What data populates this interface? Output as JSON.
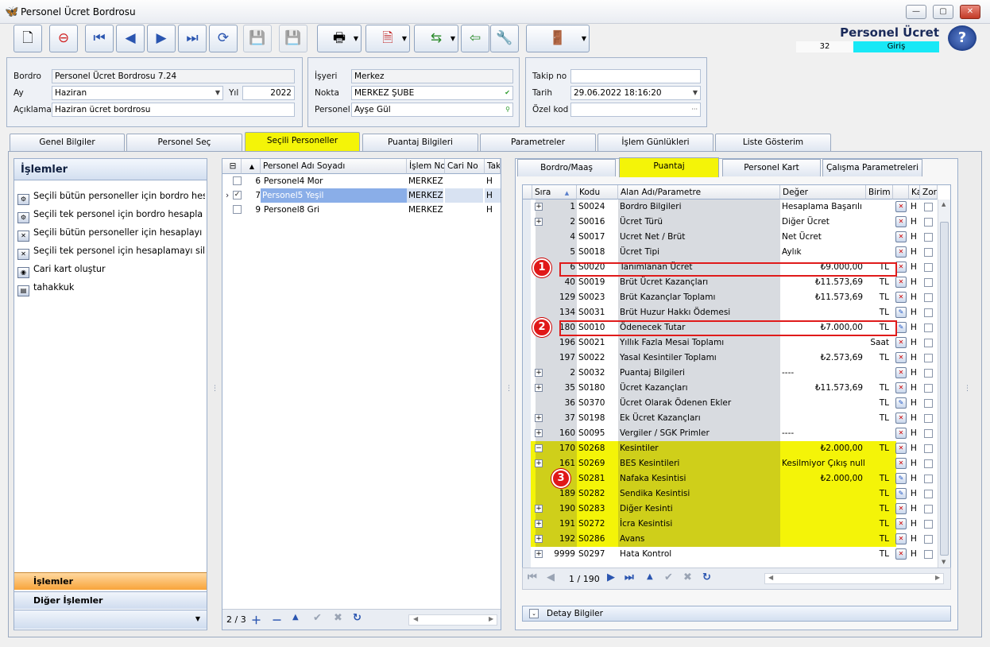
{
  "window": {
    "title": "Personel Ücret Bordrosu"
  },
  "header": {
    "title": "Personel Ücret Bordrosu",
    "count": "32",
    "mode": "Giriş"
  },
  "form": {
    "bordro_label": "Bordro",
    "bordro_value": "Personel Ücret Bordrosu 7.24",
    "ay_label": "Ay",
    "ay_value": "Haziran",
    "yil_label": "Yıl",
    "yil_value": "2022",
    "aciklama_label": "Açıklama",
    "aciklama_value": "Haziran ücret bordrosu",
    "isyeri_label": "İşyeri",
    "isyeri_value": "Merkez",
    "nokta_label": "Nokta",
    "nokta_value": "MERKEZ ŞUBE",
    "personel_label": "Personel",
    "personel_value": "Ayşe Gül",
    "takip_label": "Takip no",
    "takip_value": "",
    "tarih_label": "Tarih",
    "tarih_value": "29.06.2022 18:16:20",
    "ozel_label": "Özel kod",
    "ozel_value": ""
  },
  "main_tabs": [
    "Genel Bilgiler",
    "Personel Seç",
    "Seçili Personeller",
    "Puantaj Bilgileri",
    "Parametreler",
    "İşlem Günlükleri",
    "Liste Gösterim"
  ],
  "operations": {
    "title": "İşlemler",
    "items": [
      "Seçili bütün personeller için bordro hes...",
      "Seçili tek personel için bordro hesapla",
      "Seçili bütün personeller için hesaplayı sil",
      "Seçili tek personel için hesaplamayı sil",
      "Cari kart oluştur",
      "tahakkuk"
    ],
    "nav_islemler": "İşlemler",
    "nav_diger": "Diğer İşlemler"
  },
  "employees": {
    "columns": [
      "Personel Adı Soyadı",
      "İşlem Nok",
      "Cari No",
      "Tak"
    ],
    "rows": [
      {
        "no": "6",
        "name": "Personel4 Mor",
        "nokta": "MERKEZ Ş",
        "cari": "",
        "tak": "H",
        "checked": false
      },
      {
        "no": "7",
        "name": "Personel5 Yeşil",
        "nokta": "MERKEZ Ş",
        "cari": "",
        "tak": "H",
        "checked": true
      },
      {
        "no": "9",
        "name": "Personel8 Gri",
        "nokta": "MERKEZ Ş",
        "cari": "",
        "tak": "H",
        "checked": false
      }
    ],
    "pager": "2 / 3"
  },
  "sub_tabs": [
    "Bordro/Maaş",
    "Puantaj",
    "Personel Kart",
    "Çalışma Parametreleri"
  ],
  "grid": {
    "columns": [
      "Sıra",
      "Kodu",
      "Alan Adı/Parametre",
      "Değer",
      "Birim",
      "Ka",
      "Zor"
    ],
    "rows": [
      {
        "exp": "+",
        "sira": "1",
        "kod": "S0024",
        "ad": "Bordro Bilgileri",
        "deger": "Hesaplama Başarılı",
        "birim": "",
        "ka": "H"
      },
      {
        "exp": "+",
        "sira": "2",
        "kod": "S0016",
        "ad": "Ücret Türü",
        "deger": "Diğer Ücret",
        "birim": "",
        "ka": "H"
      },
      {
        "exp": "",
        "sira": "4",
        "kod": "S0017",
        "ad": "Ucret Net / Brüt",
        "deger": "Net Ücret",
        "birim": "",
        "ka": "H"
      },
      {
        "exp": "",
        "sira": "5",
        "kod": "S0018",
        "ad": "Ücret Tipi",
        "deger": "Aylık",
        "birim": "",
        "ka": "H"
      },
      {
        "exp": "",
        "sira": "6",
        "kod": "S0020",
        "ad": "Tanımlanan Ücret",
        "deger": "₺9.000,00",
        "birim": "TL",
        "ka": "H"
      },
      {
        "exp": "",
        "sira": "40",
        "kod": "S0019",
        "ad": "Brüt Ücret Kazançları",
        "deger": "₺11.573,69",
        "birim": "TL",
        "ka": "H"
      },
      {
        "exp": "",
        "sira": "129",
        "kod": "S0023",
        "ad": "Brüt Kazançlar Toplamı",
        "deger": "₺11.573,69",
        "birim": "TL",
        "ka": "H"
      },
      {
        "exp": "",
        "sira": "134",
        "kod": "S0031",
        "ad": "Brüt Huzur Hakkı Ödemesi",
        "deger": "",
        "birim": "TL",
        "ka": "H"
      },
      {
        "exp": "",
        "sira": "180",
        "kod": "S0010",
        "ad": "Ödenecek Tutar",
        "deger": "₺7.000,00",
        "birim": "TL",
        "ka": "H"
      },
      {
        "exp": "",
        "sira": "196",
        "kod": "S0021",
        "ad": "Yıllık Fazla Mesai Toplamı",
        "deger": "",
        "birim": "Saat",
        "ka": "H"
      },
      {
        "exp": "",
        "sira": "197",
        "kod": "S0022",
        "ad": "Yasal Kesintiler Toplamı",
        "deger": "₺2.573,69",
        "birim": "TL",
        "ka": "H"
      },
      {
        "exp": "+",
        "sira": "2",
        "kod": "S0032",
        "ad": "Puantaj Bilgileri",
        "deger": "----",
        "birim": "",
        "ka": "H"
      },
      {
        "exp": "+",
        "sira": "35",
        "kod": "S0180",
        "ad": "Ücret Kazançları",
        "deger": "₺11.573,69",
        "birim": "TL",
        "ka": "H"
      },
      {
        "exp": "",
        "sira": "36",
        "kod": "S0370",
        "ad": "Ücret Olarak Ödenen Ekler",
        "deger": "",
        "birim": "TL",
        "ka": "H"
      },
      {
        "exp": "+",
        "sira": "37",
        "kod": "S0198",
        "ad": "Ek Ücret Kazançları",
        "deger": "",
        "birim": "TL",
        "ka": "H"
      },
      {
        "exp": "+",
        "sira": "160",
        "kod": "S0095",
        "ad": "Vergiler / SGK Primler",
        "deger": "----",
        "birim": "",
        "ka": "H"
      },
      {
        "exp": "-",
        "sira": "170",
        "kod": "S0268",
        "ad": "Kesintiler",
        "deger": "₺2.000,00",
        "birim": "TL",
        "ka": "H"
      },
      {
        "exp": "+",
        "sira": "161",
        "kod": "S0269",
        "ad": "BES Kesintileri",
        "deger": "Kesilmiyor Çıkış null",
        "birim": "",
        "ka": "H"
      },
      {
        "exp": "",
        "sira": "",
        "kod": "S0281",
        "ad": "Nafaka Kesintisi",
        "deger": "₺2.000,00",
        "birim": "TL",
        "ka": "H"
      },
      {
        "exp": "",
        "sira": "189",
        "kod": "S0282",
        "ad": "Sendika Kesintisi",
        "deger": "",
        "birim": "TL",
        "ka": "H"
      },
      {
        "exp": "+",
        "sira": "190",
        "kod": "S0283",
        "ad": "Diğer Kesinti",
        "deger": "",
        "birim": "TL",
        "ka": "H"
      },
      {
        "exp": "+",
        "sira": "191",
        "kod": "S0272",
        "ad": "İcra Kesintisi",
        "deger": "",
        "birim": "TL",
        "ka": "H"
      },
      {
        "exp": "+",
        "sira": "192",
        "kod": "S0286",
        "ad": "Avans",
        "deger": "",
        "birim": "TL",
        "ka": "H"
      },
      {
        "exp": "+",
        "sira": "9999",
        "kod": "S0297",
        "ad": "Hata Kontrol",
        "deger": "",
        "birim": "TL",
        "ka": "H"
      }
    ],
    "pager": "1 / 190",
    "badges": [
      "1",
      "2",
      "3"
    ],
    "highlight_color": "#f4f408",
    "annotation_color": "#e01b1b"
  },
  "detay": "Detay Bilgiler"
}
